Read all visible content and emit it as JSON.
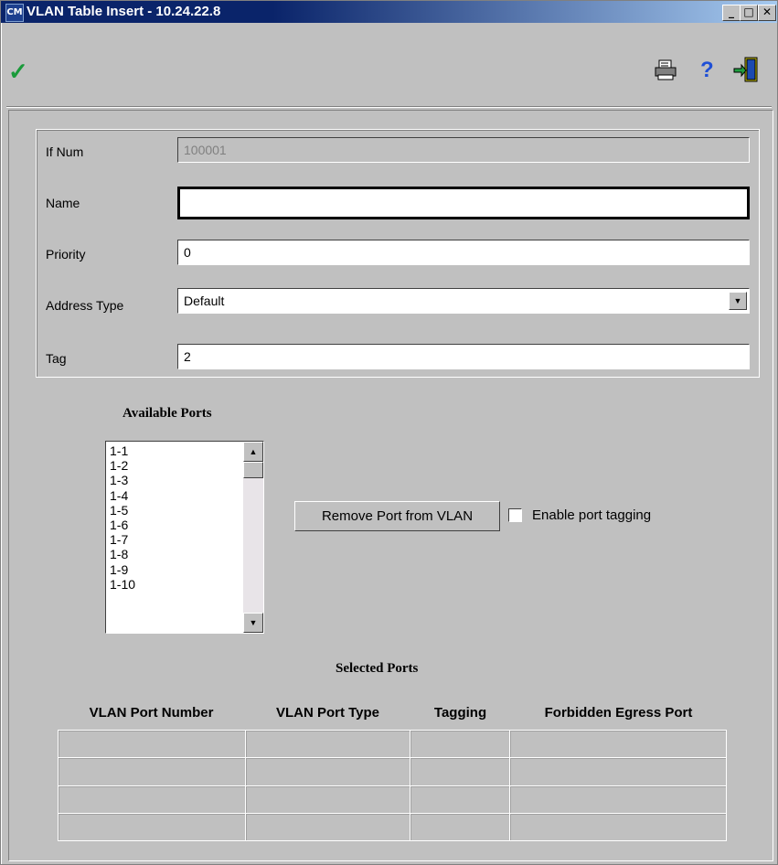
{
  "window": {
    "title": "VLAN Table Insert - 10.24.22.8",
    "app_icon_text": "CM",
    "controls": {
      "minimize": "_",
      "maximize": "□",
      "close": "✕"
    }
  },
  "toolbar": {
    "apply_icon": "checkmark-icon",
    "print_icon": "printer-icon",
    "help_icon": "help-icon",
    "exit_icon": "exit-door-icon",
    "help_glyph": "?"
  },
  "form": {
    "ifnum": {
      "label": "If Num",
      "value": "100001"
    },
    "name": {
      "label": "Name",
      "value": ""
    },
    "priority": {
      "label": "Priority",
      "value": "0"
    },
    "address_type": {
      "label": "Address Type",
      "value": "Default"
    },
    "tag": {
      "label": "Tag",
      "value": "2"
    }
  },
  "available_ports": {
    "heading": "Available Ports",
    "items": [
      "1-1",
      "1-2",
      "1-3",
      "1-4",
      "1-5",
      "1-6",
      "1-7",
      "1-8",
      "1-9",
      "1-10"
    ]
  },
  "actions": {
    "remove_port_label": "Remove Port from VLAN",
    "enable_tagging_label": "Enable port tagging",
    "enable_tagging_checked": false
  },
  "selected_ports": {
    "heading": "Selected Ports",
    "columns": [
      "VLAN Port Number",
      "VLAN Port Type",
      "Tagging",
      "Forbidden Egress Port"
    ],
    "rows": [
      [
        "",
        "",
        "",
        ""
      ],
      [
        "",
        "",
        "",
        ""
      ],
      [
        "",
        "",
        "",
        ""
      ],
      [
        "",
        "",
        "",
        ""
      ]
    ]
  }
}
